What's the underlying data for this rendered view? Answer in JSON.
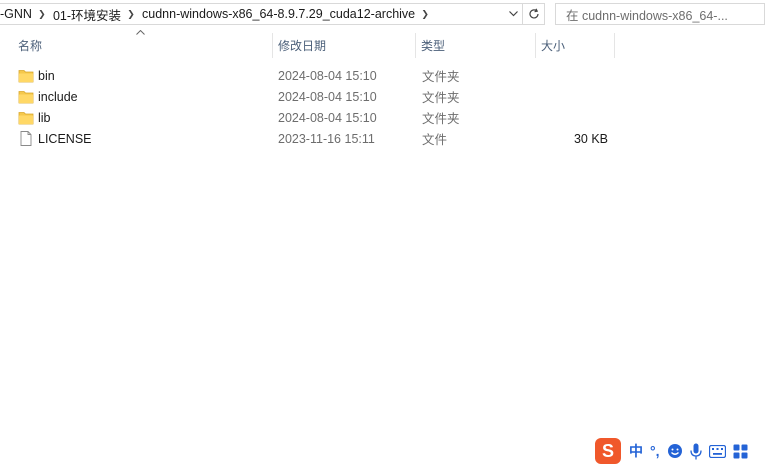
{
  "address_bar": {
    "crumbs": [
      "-GNN",
      "01-环境安装",
      "cudnn-windows-x86_64-8.9.7.29_cuda12-archive"
    ],
    "dropdown_icon": "chevron-down-icon",
    "refresh_icon": "refresh-icon"
  },
  "search": {
    "placeholder": "在 cudnn-windows-x86_64-..."
  },
  "columns": {
    "name": "名称",
    "date": "修改日期",
    "type": "类型",
    "size": "大小"
  },
  "files": [
    {
      "name": "bin",
      "date": "2024-08-04 15:10",
      "type": "文件夹",
      "size": "",
      "icon": "folder-icon"
    },
    {
      "name": "include",
      "date": "2024-08-04 15:10",
      "type": "文件夹",
      "size": "",
      "icon": "folder-icon"
    },
    {
      "name": "lib",
      "date": "2024-08-04 15:10",
      "type": "文件夹",
      "size": "",
      "icon": "folder-icon"
    },
    {
      "name": "LICENSE",
      "date": "2023-11-16 15:11",
      "type": "文件",
      "size": "30 KB",
      "icon": "file-icon"
    }
  ],
  "ime_toolbar": {
    "logo": "sogou-logo-icon",
    "lang": "中",
    "punct": "°,",
    "emoji": "emoji-icon",
    "voice": "microphone-icon",
    "keyboard": "keyboard-icon",
    "more": "grid-menu-icon"
  },
  "colors": {
    "folder": "#f5c84c",
    "header_text": "#4c607a",
    "ime_blue": "#2463d6",
    "sogou_orange": "#f0582b"
  }
}
